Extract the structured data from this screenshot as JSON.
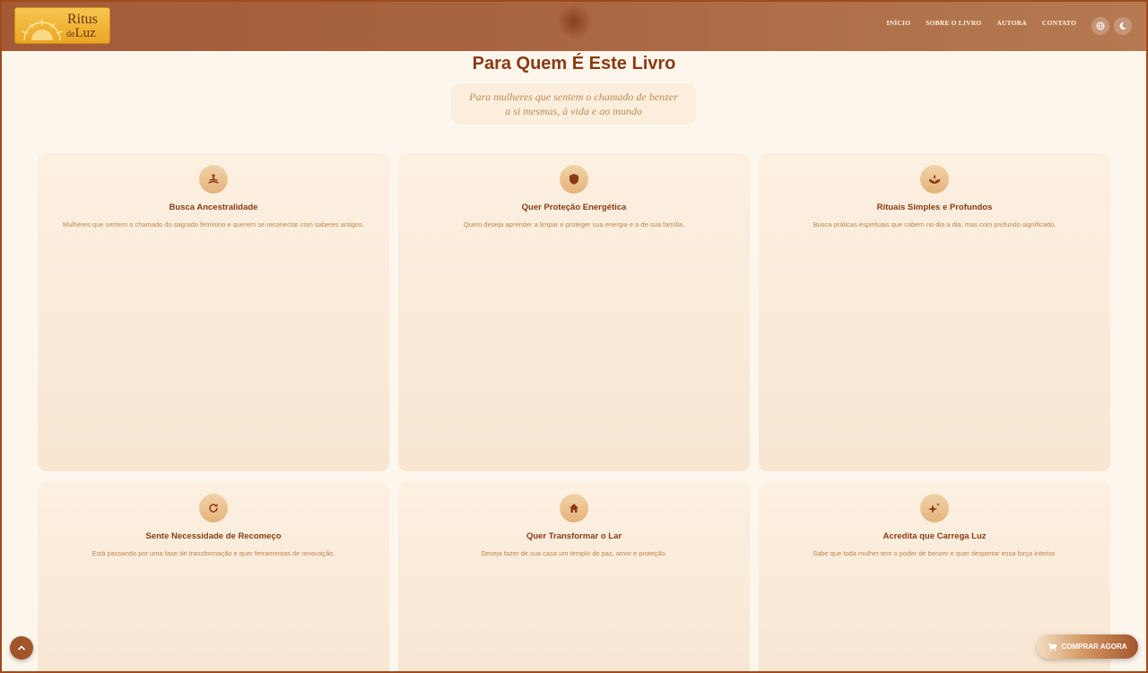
{
  "header": {
    "logo": {
      "line1": "Ritus",
      "line2_small": "de",
      "line2": "Luz"
    },
    "nav": [
      {
        "label": "INÍCIO"
      },
      {
        "label": "SOBRE O LIVRO"
      },
      {
        "label": "AUTORA"
      },
      {
        "label": "CONTATO"
      }
    ],
    "language_icon": "globe-icon",
    "theme_icon": "moon-icon"
  },
  "section": {
    "title": "Para Quem É Este Livro",
    "subtitle_line1": "Para mulheres que sentem o chamado de benzer",
    "subtitle_line2": "a si mesmas, à vida e ao mundo"
  },
  "cards": [
    {
      "icon": "meditation-icon",
      "title": "Busca Ancestralidade",
      "desc": "Mulheres que sentem o chamado do sagrado feminino e querem se reconectar com saberes antigos."
    },
    {
      "icon": "shield-icon",
      "title": "Quer Proteção Energética",
      "desc": "Quem deseja aprender a limpar e proteger sua energia e a de sua família."
    },
    {
      "icon": "hand-plant-icon",
      "title": "Rituais Simples e Profundos",
      "desc": "Busca práticas espirituais que cabem no dia a dia, mas com profundo significado."
    },
    {
      "icon": "refresh-icon",
      "title": "Sente Necessidade de Recomeço",
      "desc": "Está passando por uma fase de transformação e quer ferramentas de renovação."
    },
    {
      "icon": "home-icon",
      "title": "Quer Transformar o Lar",
      "desc": "Deseja fazer de sua casa um templo de paz, amor e proteção."
    },
    {
      "icon": "sparkles-icon",
      "title": "Acredita que Carrega Luz",
      "desc": "Sabe que toda mulher tem o poder de benzer e quer despertar essa força interior."
    }
  ],
  "buy_button": {
    "label": "COMPRAR AGORA",
    "icon": "cart-icon"
  },
  "scroll_top_icon": "chevron-up-icon",
  "colors": {
    "accent": "#8a3a14",
    "header": "#a86540",
    "background": "#fdf6ec",
    "logo": "#f2b93c"
  }
}
